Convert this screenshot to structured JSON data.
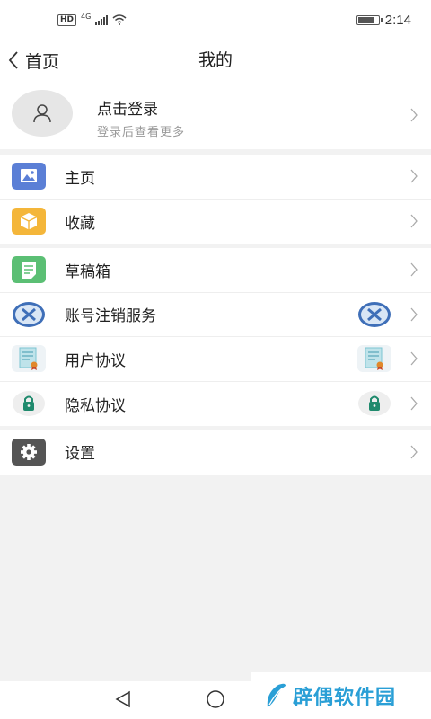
{
  "status_bar": {
    "network_badge": "HD",
    "network_type": "4G",
    "time": "2:14",
    "battery_level": 0.85
  },
  "nav": {
    "back_label": "首页",
    "title": "我的"
  },
  "profile": {
    "name": "点击登录",
    "subtitle": "登录后查看更多"
  },
  "menu_groups": [
    [
      {
        "label": "主页",
        "icon": "image-icon"
      },
      {
        "label": "收藏",
        "icon": "box-icon"
      }
    ],
    [
      {
        "label": "草稿箱",
        "icon": "draft-icon"
      },
      {
        "label": "账号注销服务",
        "icon": "cancel-icon"
      },
      {
        "label": "用户协议",
        "icon": "certificate-icon"
      },
      {
        "label": "隐私协议",
        "icon": "lock-icon"
      }
    ],
    [
      {
        "label": "设置",
        "icon": "gear-icon"
      }
    ]
  ],
  "watermark": {
    "text": "辟偶软件园"
  },
  "colors": {
    "blue_icon": "#5b7fd6",
    "yellow_icon": "#f4b63a",
    "green_icon": "#5bbf74",
    "gray_icon": "#555555",
    "watermark": "#2a9fd6"
  }
}
